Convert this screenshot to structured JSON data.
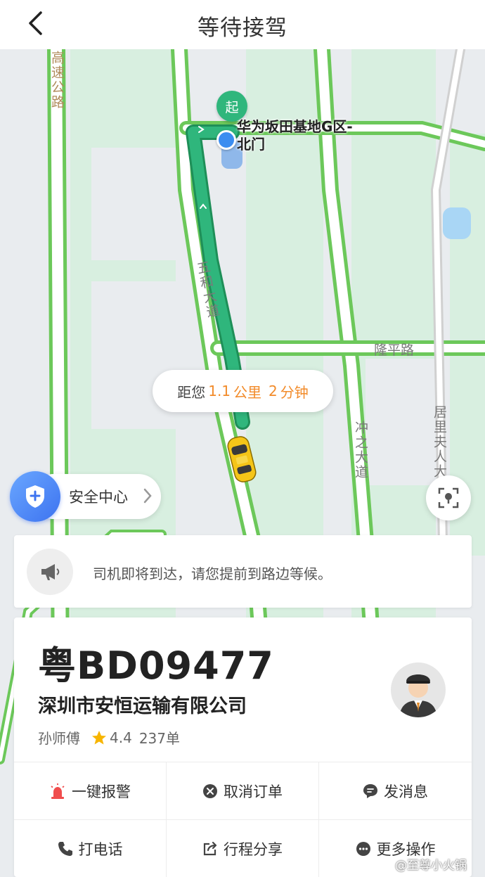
{
  "header": {
    "title": "等待接驾"
  },
  "map": {
    "poi_label": "华为坂田基地G区-北门",
    "start_marker": "起",
    "road_labels": [
      "高速公路",
      "五和大道",
      "隆平路",
      "冲之大道",
      "居里夫人大"
    ],
    "eta": {
      "prefix": "距您",
      "distance": "1.1",
      "distance_unit": "公里",
      "minutes": "2",
      "minutes_unit": "分钟"
    },
    "colors": {
      "route": "#2fb67c",
      "traffic": "#6cc85a",
      "accent": "#f28b2a",
      "taxi": "#f5c518"
    }
  },
  "safety": {
    "label": "安全中心"
  },
  "notice": {
    "text": "司机即将到达，请您提前到路边等候。"
  },
  "driver": {
    "plate": "粤BD09477",
    "company": "深圳市安恒运输有限公司",
    "name": "孙师傅",
    "rating": "4.4",
    "orders": "237单"
  },
  "actions": [
    {
      "label": "一键报警",
      "icon": "alarm-icon"
    },
    {
      "label": "取消订单",
      "icon": "cancel-icon"
    },
    {
      "label": "发消息",
      "icon": "message-icon"
    },
    {
      "label": "打电话",
      "icon": "phone-icon"
    },
    {
      "label": "行程分享",
      "icon": "share-icon"
    },
    {
      "label": "更多操作",
      "icon": "more-icon"
    }
  ],
  "watermark": "@至尊小火锅"
}
